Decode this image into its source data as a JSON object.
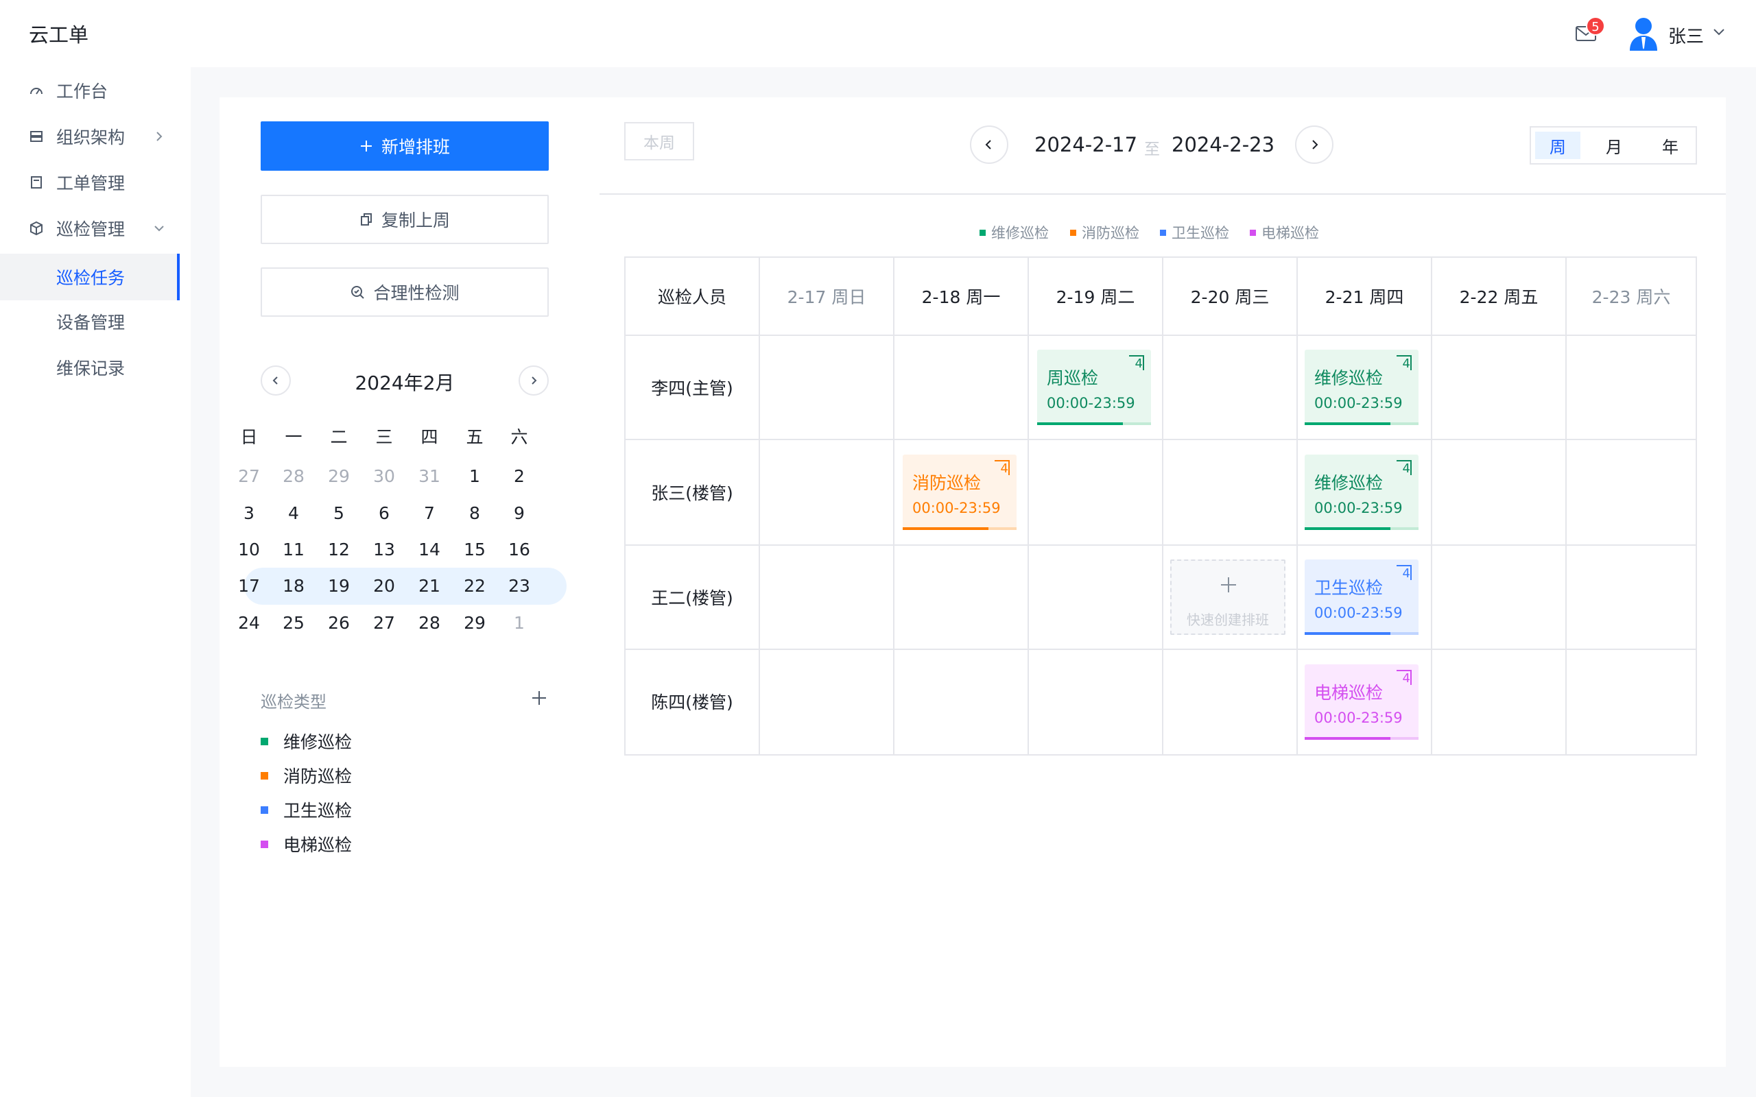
{
  "app": {
    "title": "云工单"
  },
  "header": {
    "mail_badge": "5",
    "user_name": "张三"
  },
  "sidebar": {
    "items": [
      {
        "label": "工作台"
      },
      {
        "label": "组织架构"
      },
      {
        "label": "工单管理"
      },
      {
        "label": "巡检管理"
      },
      {
        "label": "巡检任务"
      },
      {
        "label": "设备管理"
      },
      {
        "label": "维保记录"
      }
    ]
  },
  "left_panel": {
    "add_label": "新增排班",
    "copy_label": "复制上周",
    "check_label": "合理性检测",
    "calendar": {
      "title": "2024年2月",
      "weekdays": [
        "日",
        "一",
        "二",
        "三",
        "四",
        "五",
        "六"
      ],
      "weeks": [
        [
          "27",
          "28",
          "29",
          "30",
          "31",
          "1",
          "2"
        ],
        [
          "3",
          "4",
          "5",
          "6",
          "7",
          "8",
          "9"
        ],
        [
          "10",
          "11",
          "12",
          "13",
          "14",
          "15",
          "16"
        ],
        [
          "17",
          "18",
          "19",
          "20",
          "21",
          "22",
          "23"
        ],
        [
          "24",
          "25",
          "26",
          "27",
          "28",
          "29",
          "1"
        ]
      ]
    },
    "types_title": "巡检类型",
    "types": [
      {
        "label": "维修巡检",
        "color": "#00b42a"
      },
      {
        "label": "消防巡检",
        "color": "#ff7d00"
      },
      {
        "label": "卫生巡检",
        "color": "#3c7eff"
      },
      {
        "label": "电梯巡检",
        "color": "#d44ef0"
      }
    ]
  },
  "schedule": {
    "this_week_label": "本周",
    "range_start": "2024-2-17",
    "range_sep": "至",
    "range_end": "2024-2-23",
    "views": [
      "周",
      "月",
      "年"
    ],
    "legend": [
      "维修巡检",
      "消防巡检",
      "卫生巡检",
      "电梯巡检"
    ],
    "corner_label": "巡检人员",
    "days": [
      "2-17 周日",
      "2-18 周一",
      "2-19 周二",
      "2-20 周三",
      "2-21 周四",
      "2-22 周五",
      "2-23 周六"
    ],
    "people": [
      "李四(主管)",
      "张三(楼管)",
      "王二(楼管)",
      "陈四(楼管)"
    ],
    "tasks": [
      {
        "name": "周巡检",
        "time": "00:00-23:59",
        "count": "4",
        "type": "维修巡检",
        "progress": 0.75
      },
      {
        "name": "维修巡检",
        "time": "00:00-23:59",
        "count": "4",
        "type": "维修巡检",
        "progress": 0.75
      },
      {
        "name": "消防巡检",
        "time": "00:00-23:59",
        "count": "4",
        "type": "消防巡检",
        "progress": 0.75
      },
      {
        "name": "维修巡检",
        "time": "00:00-23:59",
        "count": "4",
        "type": "维修巡检",
        "progress": 0.75
      },
      {
        "name": "卫生巡检",
        "time": "00:00-23:59",
        "count": "4",
        "type": "卫生巡检",
        "progress": 0.75
      },
      {
        "name": "电梯巡检",
        "time": "00:00-23:59",
        "count": "4",
        "type": "电梯巡检",
        "progress": 0.75
      }
    ],
    "quick_create_label": "快速创建排班"
  },
  "colors": {
    "primary": "#1677ff",
    "repair_bg": "#e8f7ef",
    "repair_fg": "#00a870",
    "fire_bg": "#fff3e8",
    "fire_fg": "#ff7d00",
    "hygiene_bg": "#e8f0ff",
    "hygiene_fg": "#3c7eff",
    "elevator_bg": "#fbe8ff",
    "elevator_fg": "#d44ef0"
  }
}
